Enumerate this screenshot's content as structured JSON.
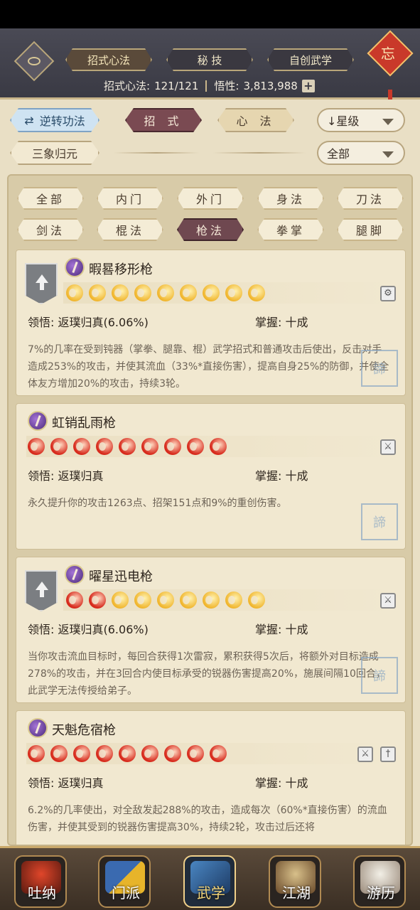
{
  "header": {
    "tabs": [
      "招式心法",
      "秘 技",
      "自创武学"
    ],
    "stats_label1": "招式心法:",
    "stats_value1": "121/121",
    "stats_label2": "悟性:",
    "stats_value2": "3,813,988",
    "plus": "+",
    "knot_char": "忘"
  },
  "controls": {
    "reverse_label": "逆转功法",
    "zhaoshi_label": "招 式",
    "xinfa_label": "心 法",
    "sort_label": "↓星级",
    "sanxiang_label": "三象归元",
    "filter_label": "全部"
  },
  "categories": [
    {
      "label": "全部",
      "active": false
    },
    {
      "label": "内门",
      "active": false
    },
    {
      "label": "外门",
      "active": false
    },
    {
      "label": "身法",
      "active": false
    },
    {
      "label": "刀法",
      "active": false
    },
    {
      "label": "剑法",
      "active": false
    },
    {
      "label": "棍法",
      "active": false
    },
    {
      "label": "枪法",
      "active": true
    },
    {
      "label": "拳掌",
      "active": false
    },
    {
      "label": "腿脚",
      "active": false
    }
  ],
  "cards": [
    {
      "title": "暇晷移形枪",
      "has_lift": true,
      "flames": [
        "gold",
        "gold",
        "gold",
        "gold",
        "gold",
        "gold",
        "gold",
        "gold",
        "gold"
      ],
      "lingwu_label": "领悟:",
      "lingwu_value": "返璞归真(6.06%)",
      "zhangwo_label": "掌握:",
      "zhangwo_value": "十成",
      "desc": "7%的几率在受到钝器（掌拳、腿靠、棍）武学招式和普通攻击后使出，反击对手造成253%的攻击，并使其流血（33%*直接伤害），提高自身25%的防御，并使全体友方增加20%的攻击，持续3轮。",
      "weapons": [
        "⚙"
      ]
    },
    {
      "title": "虹销乱雨枪",
      "has_lift": false,
      "flames": [
        "red",
        "red",
        "red",
        "red",
        "red",
        "red",
        "red",
        "red",
        "red"
      ],
      "lingwu_label": "领悟:",
      "lingwu_value": "返璞归真",
      "zhangwo_label": "掌握:",
      "zhangwo_value": "十成",
      "desc": "永久提升你的攻击1263点、招架151点和9%的重创伤害。",
      "weapons": [
        "⚔"
      ]
    },
    {
      "title": "曜星迅电枪",
      "has_lift": true,
      "flames": [
        "red",
        "red",
        "gold",
        "gold",
        "gold",
        "gold",
        "gold",
        "gold",
        "gold"
      ],
      "lingwu_label": "领悟:",
      "lingwu_value": "返璞归真(6.06%)",
      "zhangwo_label": "掌握:",
      "zhangwo_value": "十成",
      "desc": "当你攻击流血目标时，每回合获得1次雷寂，累积获得5次后，将额外对目标造成278%的攻击，并在3回合内使目标承受的锐器伤害提高20%，施展间隔10回合，此武学无法传授给弟子。",
      "weapons": [
        "⚔"
      ]
    },
    {
      "title": "天魁危宿枪",
      "has_lift": false,
      "flames": [
        "red",
        "red",
        "red",
        "red",
        "red",
        "red",
        "red",
        "red",
        "red"
      ],
      "lingwu_label": "领悟:",
      "lingwu_value": "返璞归真",
      "zhangwo_label": "掌握:",
      "zhangwo_value": "十成",
      "desc": "6.2%的几率使出，对全敌发起288%的攻击，造成每次（60%*直接伤害）的流血伤害，并使其受到的锐器伤害提高30%，持续2轮，攻击过后还将",
      "weapons": [
        "⚔",
        "†"
      ]
    }
  ],
  "seal_text": "諦",
  "nav": [
    {
      "label": "吐纳",
      "active": false
    },
    {
      "label": "门派",
      "active": false
    },
    {
      "label": "武学",
      "active": true
    },
    {
      "label": "江湖",
      "active": false
    },
    {
      "label": "游历",
      "active": false
    }
  ]
}
